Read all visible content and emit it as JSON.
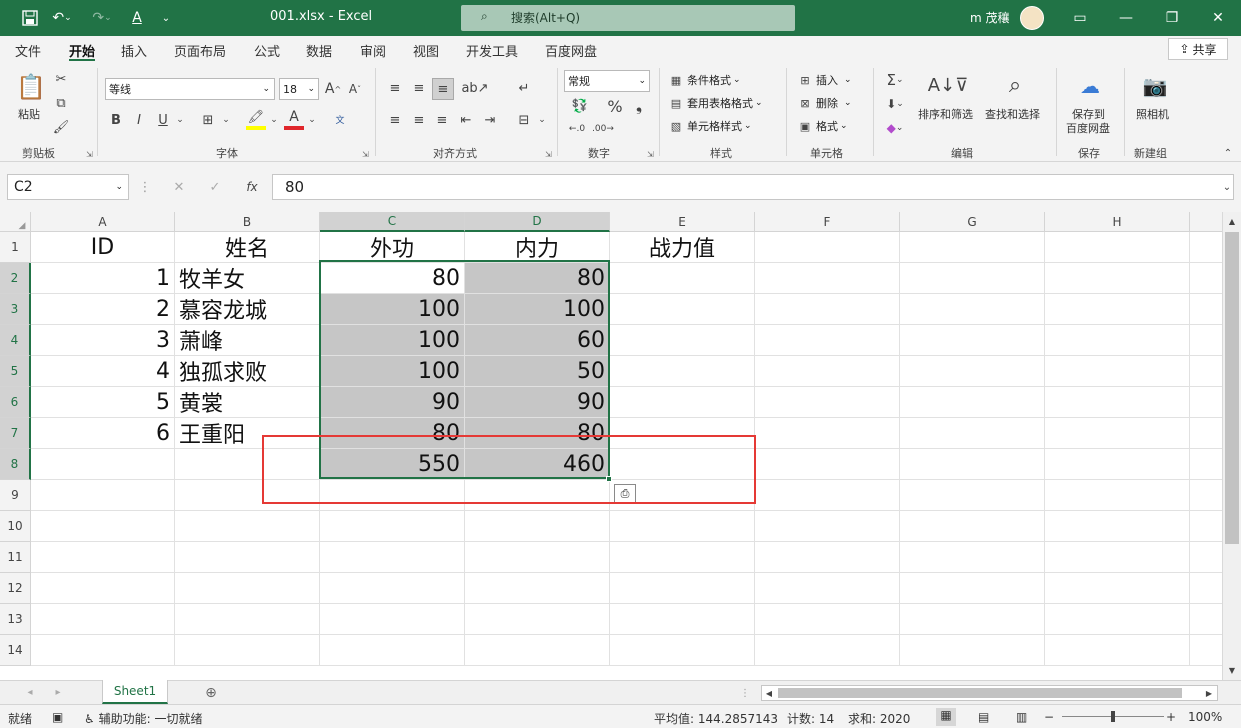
{
  "titlebar": {
    "filename": "001.xlsx",
    "app": "Excel",
    "search_placeholder": "搜索(Alt+Q)",
    "user": "m 茂穰"
  },
  "menu_tabs": [
    "文件",
    "开始",
    "插入",
    "页面布局",
    "公式",
    "数据",
    "审阅",
    "视图",
    "开发工具",
    "百度网盘"
  ],
  "active_tab": "开始",
  "share_label": "共享",
  "ribbon": {
    "clipboard": {
      "paste": "粘贴",
      "label": "剪贴板"
    },
    "font": {
      "name": "等线",
      "size": "18",
      "label": "字体",
      "bold": "B",
      "italic": "I",
      "underline": "U"
    },
    "alignment": {
      "label": "对齐方式"
    },
    "number": {
      "format": "常规",
      "label": "数字"
    },
    "styles": {
      "conditional": "条件格式",
      "table": "套用表格格式",
      "cell": "单元格样式",
      "label": "样式"
    },
    "cells": {
      "insert": "插入",
      "delete": "删除",
      "format": "格式",
      "label": "单元格"
    },
    "editing": {
      "sort": "排序和筛选",
      "find": "查找和选择",
      "label": "编辑"
    },
    "save": {
      "btn_line1": "保存到",
      "btn_line2": "百度网盘",
      "label": "保存"
    },
    "camera": {
      "btn": "照相机",
      "label": "新建组"
    }
  },
  "formula_bar": {
    "name_box": "C2",
    "fx": "fx",
    "value": "80"
  },
  "columns": [
    "A",
    "B",
    "C",
    "D",
    "E",
    "F",
    "G",
    "H"
  ],
  "rows": [
    "1",
    "2",
    "3",
    "4",
    "5",
    "6",
    "7",
    "8",
    "9",
    "10",
    "11",
    "12",
    "13",
    "14"
  ],
  "table": {
    "headers": [
      "ID",
      "姓名",
      "外功",
      "内力",
      "战力值"
    ],
    "data": [
      [
        "1",
        "牧羊女",
        "80",
        "80"
      ],
      [
        "2",
        "慕容龙城",
        "100",
        "100"
      ],
      [
        "3",
        "萧峰",
        "100",
        "60"
      ],
      [
        "4",
        "独孤求败",
        "100",
        "50"
      ],
      [
        "5",
        "黄裳",
        "90",
        "90"
      ],
      [
        "6",
        "王重阳",
        "80",
        "80"
      ]
    ],
    "totals": [
      "550",
      "460"
    ]
  },
  "sheet_tab": "Sheet1",
  "status": {
    "ready": "就绪",
    "accessibility": "辅助功能: 一切就绪",
    "average": "平均值: 144.2857143",
    "count": "计数: 14",
    "sum": "求和: 2020",
    "zoom": "100%"
  },
  "colors": {
    "brand": "#217346",
    "highlight": "#e53935"
  }
}
